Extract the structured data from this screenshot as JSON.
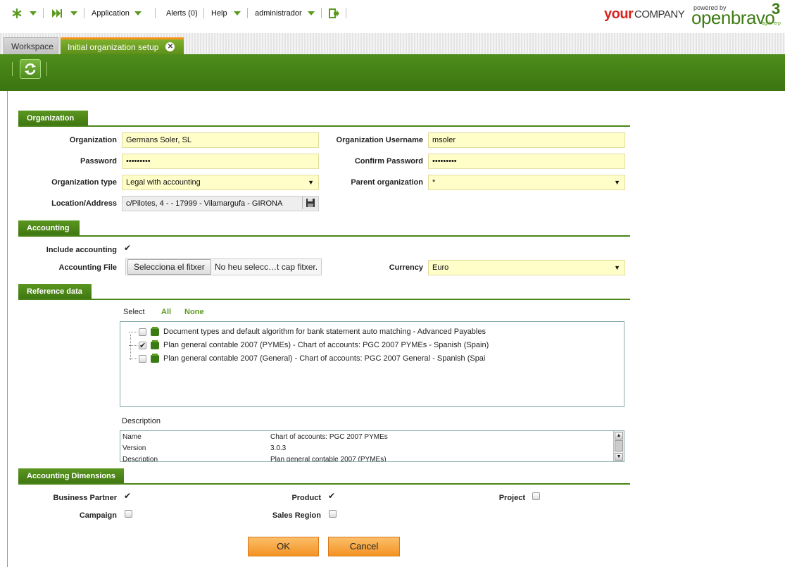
{
  "topbar": {
    "application": "Application",
    "alerts": "Alerts (0)",
    "help": "Help",
    "user": "administrador",
    "logo_your": "your",
    "logo_company": "COMPANY",
    "logo_powered": "powered by",
    "logo_openbravo": "openbravo",
    "logo_version": "3",
    "logo_tagline": "agile erp"
  },
  "tabs": {
    "workspace": "Workspace",
    "active": "Initial organization setup",
    "close": "✕"
  },
  "sections": {
    "organization": "Organization",
    "accounting": "Accounting",
    "reference": "Reference data",
    "dimensions": "Accounting Dimensions"
  },
  "organization": {
    "org_label": "Organization",
    "org_value": "Germans Soler, SL",
    "username_label": "Organization Username",
    "username_value": "msoler",
    "password_label": "Password",
    "password_value": "•••••••••",
    "confirm_label": "Confirm Password",
    "confirm_value": "•••••••••",
    "type_label": "Organization type",
    "type_value": "Legal with accounting",
    "parent_label": "Parent organization",
    "parent_value": "*",
    "location_label": "Location/Address",
    "location_value": "c/Pilotes, 4 -  - 17999 - Vilamargufa - GIRONA"
  },
  "accounting": {
    "include_label": "Include accounting",
    "include_checked": true,
    "file_label": "Accounting File",
    "file_button": "Selecciona el fitxer",
    "file_name": "No heu selecc…t cap fitxer.",
    "currency_label": "Currency",
    "currency_value": "Euro"
  },
  "reference": {
    "select_label": "Select",
    "all": "All",
    "none": "None",
    "items": [
      {
        "label": "Document types and default algorithm for bank statement auto matching - Advanced Payables",
        "checked": false
      },
      {
        "label": "Plan general contable 2007 (PYMEs) - Chart of accounts: PGC 2007 PYMEs - Spanish (Spain)",
        "checked": true
      },
      {
        "label": "Plan general contable 2007 (General) - Chart of accounts: PGC 2007 General - Spanish (Spai",
        "checked": false
      }
    ],
    "description_label": "Description",
    "description_rows": [
      {
        "key": "Name",
        "value": "Chart of accounts: PGC 2007 PYMEs"
      },
      {
        "key": "Version",
        "value": "3.0.3"
      },
      {
        "key": "Description",
        "value": "Plan general contable 2007 (PYMEs)"
      }
    ]
  },
  "dimensions": {
    "business_partner": "Business Partner",
    "product": "Product",
    "project": "Project",
    "campaign": "Campaign",
    "sales_region": "Sales Region"
  },
  "actions": {
    "ok": "OK",
    "cancel": "Cancel"
  }
}
